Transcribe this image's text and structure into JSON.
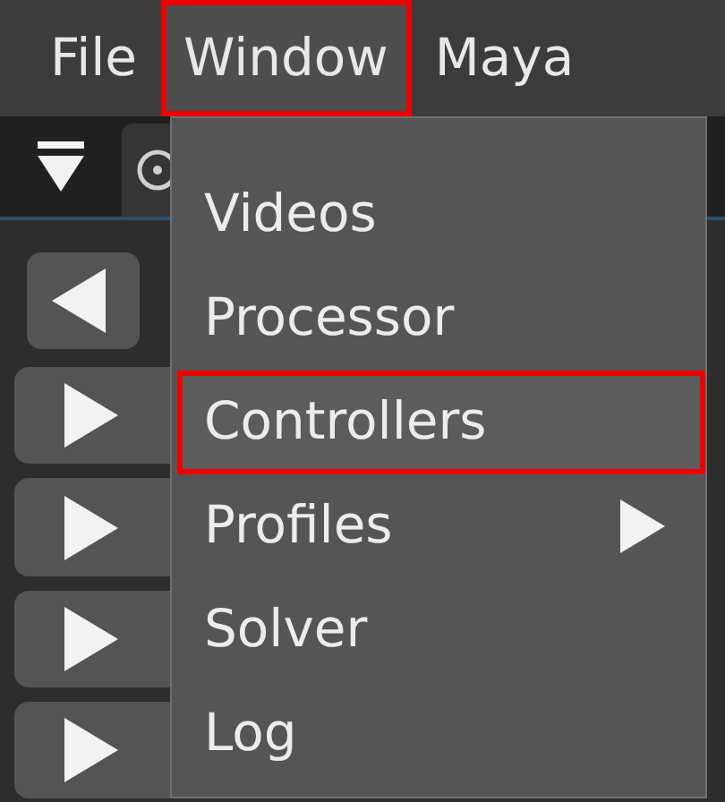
{
  "menubar": [
    {
      "label": "File",
      "selected": false
    },
    {
      "label": "Window",
      "selected": true
    },
    {
      "label": "Maya",
      "selected": false
    }
  ],
  "menu": {
    "items": [
      {
        "label": "Videos",
        "highlighted": false,
        "submenu": false
      },
      {
        "label": "Processor",
        "highlighted": false,
        "submenu": false
      },
      {
        "label": "Controllers",
        "highlighted": true,
        "submenu": false
      },
      {
        "label": "Profiles",
        "highlighted": false,
        "submenu": true
      },
      {
        "label": "Solver",
        "highlighted": false,
        "submenu": false
      },
      {
        "label": "Log",
        "highlighted": false,
        "submenu": false
      }
    ]
  },
  "side_buttons": [
    {
      "kind": "back"
    },
    {
      "kind": "play"
    },
    {
      "kind": "play"
    },
    {
      "kind": "play"
    },
    {
      "kind": "play"
    }
  ]
}
